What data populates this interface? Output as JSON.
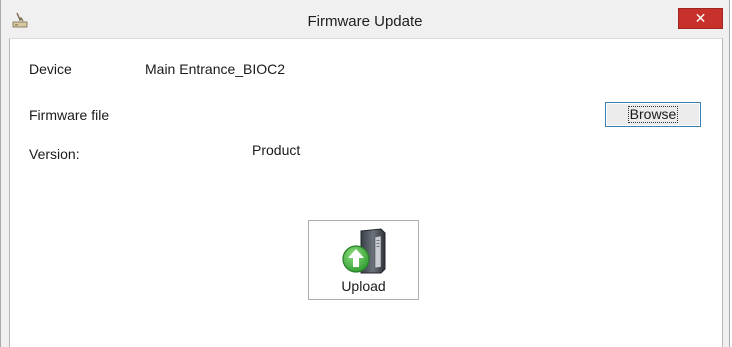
{
  "window": {
    "title": "Firmware Update",
    "icon": "firmware-app-icon",
    "close_icon": "close-icon",
    "close_glyph": "✕"
  },
  "form": {
    "device_label": "Device",
    "device_value": "Main Entrance_BIOC2",
    "firmware_file_label": "Firmware file",
    "browse_label": "Browse",
    "version_label": "Version:",
    "product_label": "Product"
  },
  "upload": {
    "label": "Upload",
    "icon": "upload-server-icon"
  },
  "colors": {
    "close_button": "#c7302b",
    "focus_border": "#3c7fb1",
    "upload_arrow": "#3aa63a"
  }
}
